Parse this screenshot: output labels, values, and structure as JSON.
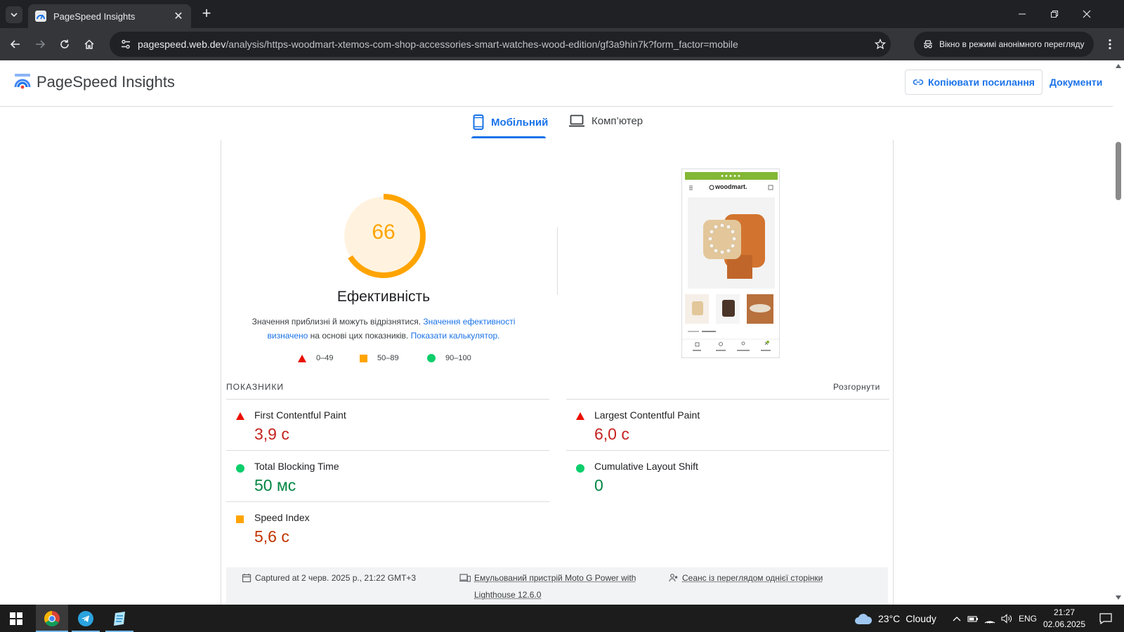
{
  "browser": {
    "tab_title": "PageSpeed Insights",
    "url_host": "pagespeed.web.dev",
    "url_path": "/analysis/https-woodmart-xtemos-com-shop-accessories-smart-watches-wood-edition/gf3a9hin7k?form_factor=mobile",
    "incognito_label": "Вікно в режимі анонімного перегляду"
  },
  "header": {
    "title": "PageSpeed Insights",
    "copy_link_label": "Копіювати посилання",
    "docs_label": "Документи"
  },
  "device_tabs": [
    {
      "label": "Мобільний",
      "selected": true
    },
    {
      "label": "Комп’ютер",
      "selected": false
    }
  ],
  "performance": {
    "score": "66",
    "score_fraction": 0.66,
    "title": "Ефективність",
    "desc_plain_1": "Значення приблизні й можуть відрізнятися. ",
    "desc_link_1": "Значення ефективності визначено",
    "desc_plain_2": " на основі цих показників. ",
    "desc_link_2": "Показати калькулятор.",
    "legend": {
      "fail": "0–49",
      "average": "50–89",
      "pass": "90–100"
    }
  },
  "screenshot": {
    "logo_text": "woodmart.",
    "breadcrumb": "Home / Accessories",
    "nav": [
      "Shop",
      "Wishlist",
      "My account",
      "Compare"
    ]
  },
  "metrics": {
    "heading": "ПОКАЗНИКИ",
    "expand_label": "Розгорнути",
    "fcp": {
      "name": "First Contentful Paint",
      "value": "3,9 с",
      "status": "fail"
    },
    "lcp": {
      "name": "Largest Contentful Paint",
      "value": "6,0 с",
      "status": "fail"
    },
    "tbt": {
      "name": "Total Blocking Time",
      "value": "50 мс",
      "status": "pass"
    },
    "cls": {
      "name": "Cumulative Layout Shift",
      "value": "0",
      "status": "pass"
    },
    "si": {
      "name": "Speed Index",
      "value": "5,6 с",
      "status": "average"
    }
  },
  "run_info": {
    "captured": "Captured at 2 черв. 2025 р., 21:22 GMT+3",
    "device_line1": "Емульований пристрій Moto G Power with",
    "device_line2": "Lighthouse 12.6.0",
    "session": "Сеанс із переглядом однієї сторінки"
  },
  "taskbar": {
    "temperature": "23°C",
    "weather": "Cloudy",
    "lang": "ENG",
    "time": "21:27",
    "date": "02.06.2025"
  },
  "colors": {
    "accent": "#1a73e8",
    "average": "#ffa400",
    "fail": "#eb0f00",
    "pass": "#0cce6b"
  }
}
